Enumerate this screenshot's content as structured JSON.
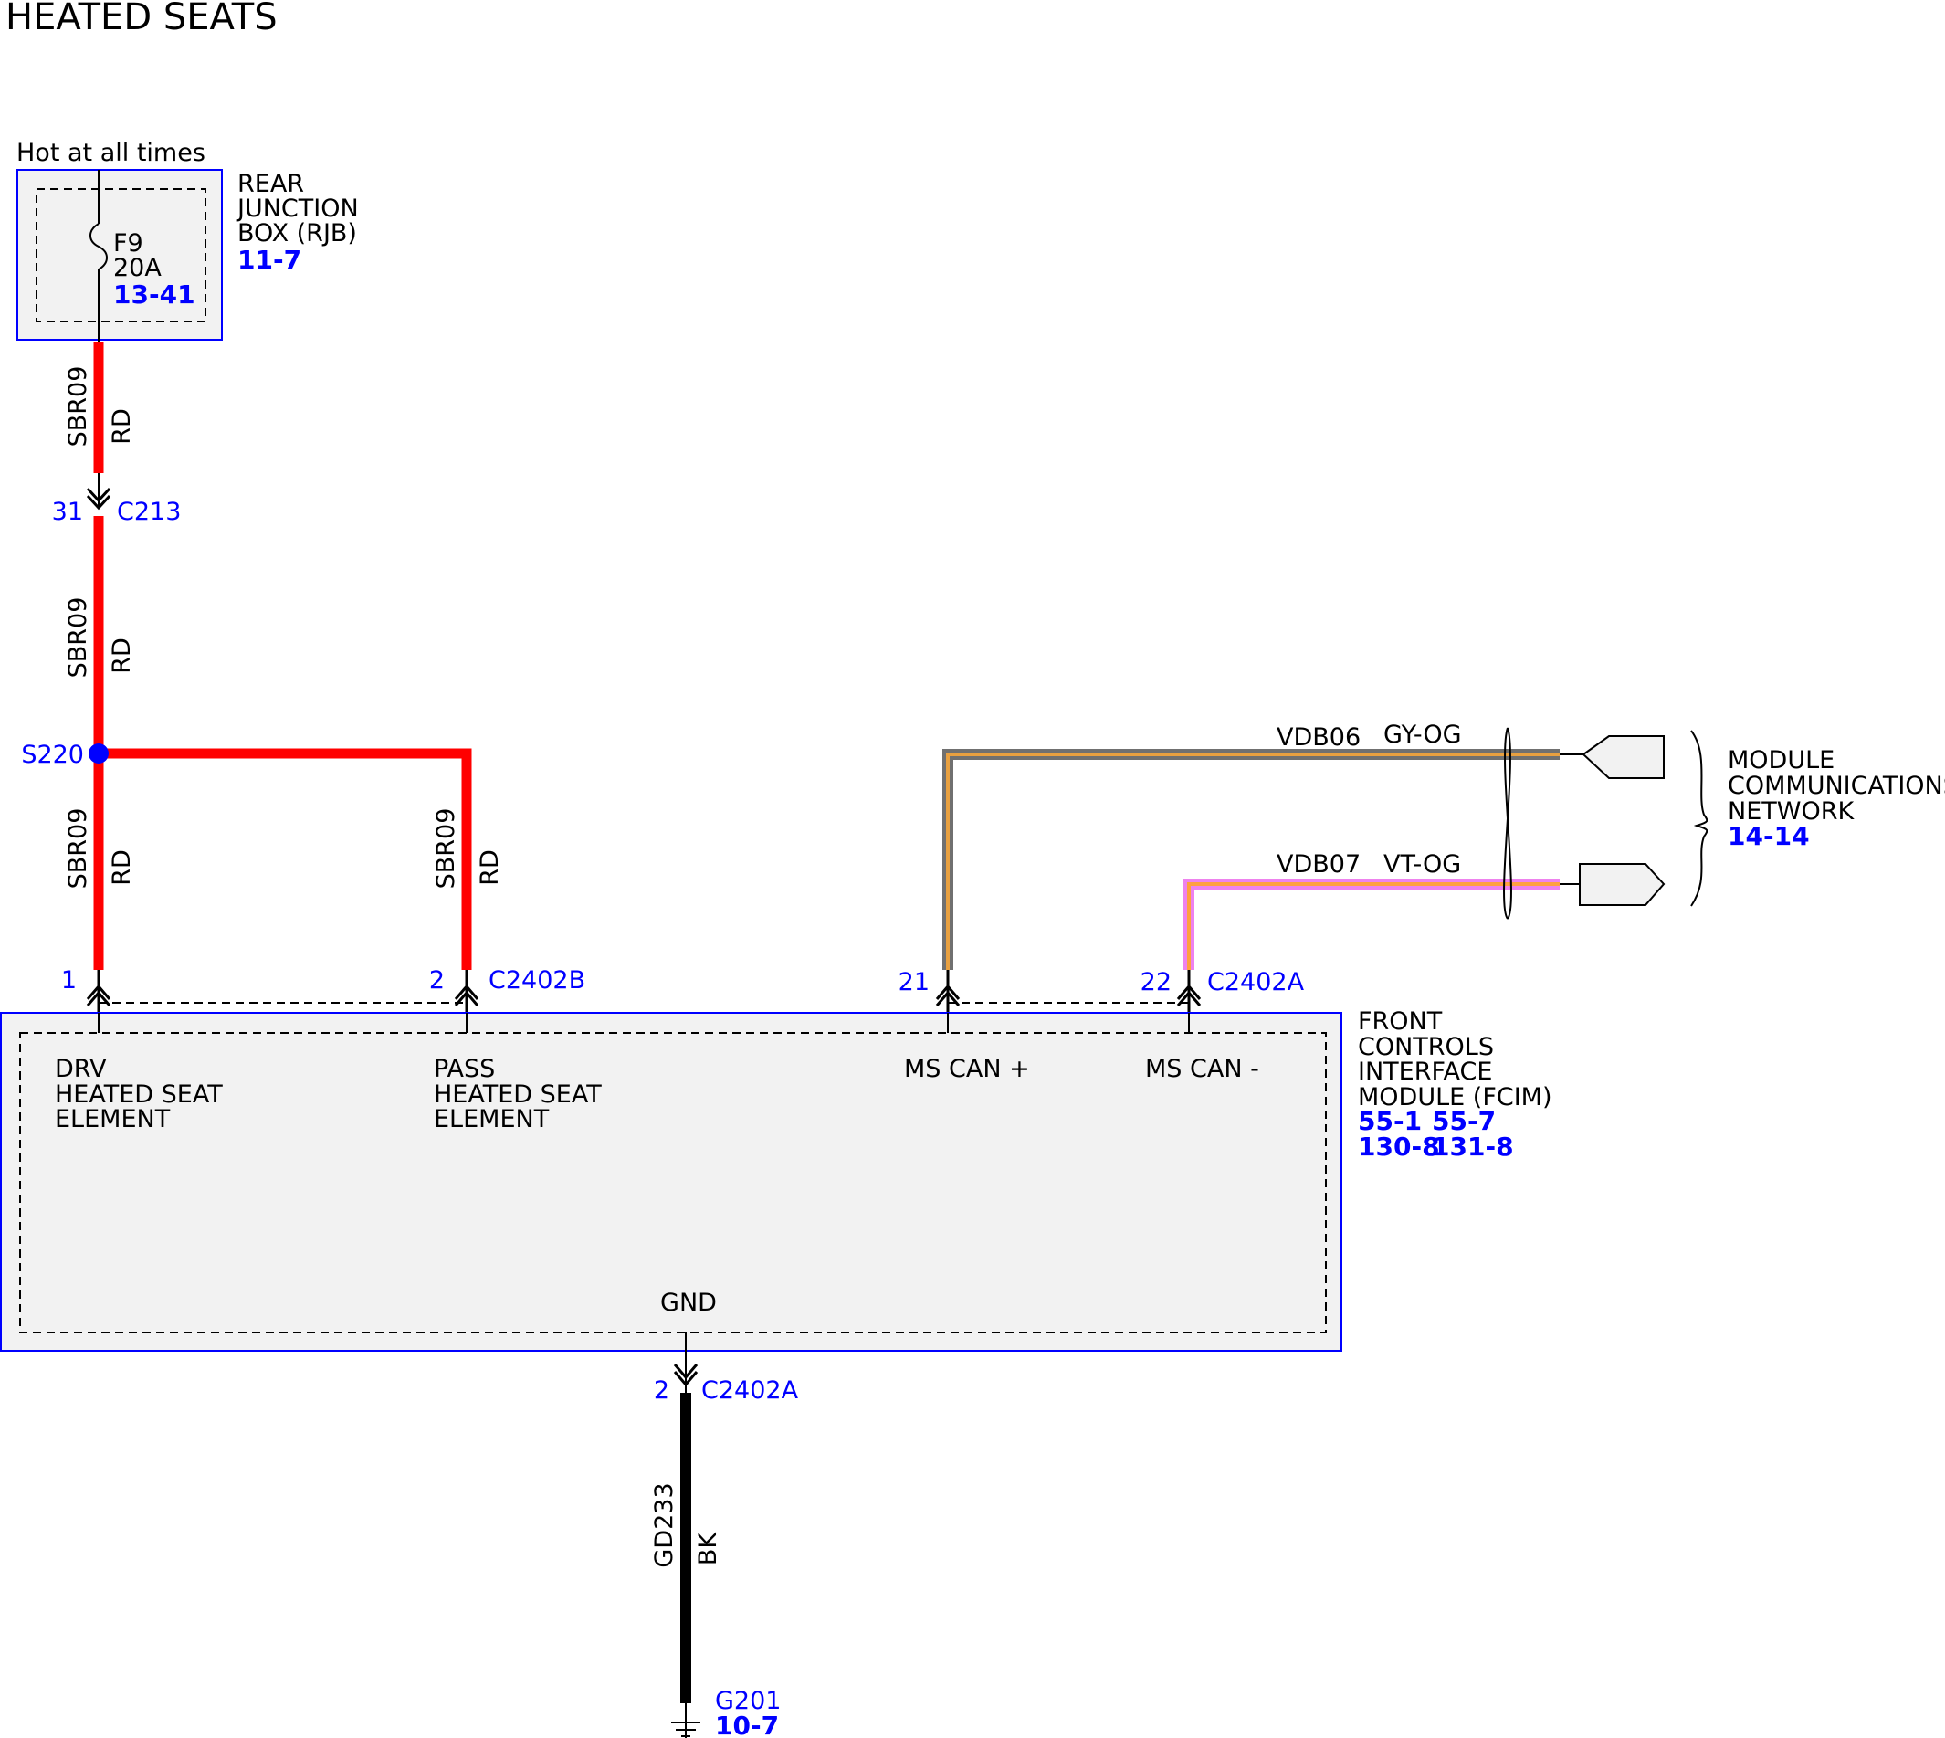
{
  "title": "HEATED SEATS",
  "colors": {
    "wire_red": "#ff0000",
    "wire_black": "#000000",
    "component_border": "#0000ff",
    "component_fill": "#f2f2f2",
    "label_blue": "#0000ff",
    "splice_blue": "#0000ff",
    "gy_og_gray": "#808080",
    "gy_og_orange": "#e8a040",
    "vt_og_violet": "#ee82ee",
    "vt_og_orange": "#ffa040"
  },
  "rjb": {
    "hot_label": "Hot at all times",
    "name_lines": [
      "REAR",
      "JUNCTION",
      "BOX (RJB)"
    ],
    "ref": "11-7",
    "fuse_name": "F9",
    "fuse_rating": "20A",
    "fuse_ref": "13-41"
  },
  "wires": {
    "sbr09_top": {
      "circuit": "SBR09",
      "color": "RD"
    },
    "sbr09_mid": {
      "circuit": "SBR09",
      "color": "RD"
    },
    "sbr09_drv": {
      "circuit": "SBR09",
      "color": "RD"
    },
    "sbr09_pass": {
      "circuit": "SBR09",
      "color": "RD"
    },
    "vdb06": {
      "circuit": "VDB06",
      "color": "GY-OG"
    },
    "vdb07": {
      "circuit": "VDB07",
      "color": "VT-OG"
    },
    "gd233": {
      "circuit": "GD233",
      "color": "BK"
    }
  },
  "c213": {
    "pin": "31",
    "name": "C213"
  },
  "splice": {
    "name": "S220"
  },
  "fcim_pins": {
    "drv_pin": "1",
    "pass_pin": "2",
    "c2402b": "C2402B",
    "mscan_plus_pin": "21",
    "mscan_minus_pin": "22",
    "c2402a": "C2402A",
    "gnd_pin": "2",
    "gnd_connector": "C2402A"
  },
  "fcim": {
    "name_lines": [
      "FRONT",
      "CONTROLS",
      "INTERFACE",
      "MODULE (FCIM)"
    ],
    "refs": [
      "55-1",
      "55-7",
      "130-8",
      "131-8"
    ],
    "drv_label": [
      "DRV",
      "HEATED SEAT",
      "ELEMENT"
    ],
    "pass_label": [
      "PASS",
      "HEATED SEAT",
      "ELEMENT"
    ],
    "mscan_plus": "MS CAN +",
    "mscan_minus": "MS CAN -",
    "gnd": "GND"
  },
  "network": {
    "name_lines": [
      "MODULE",
      "COMMUNICATIONS",
      "NETWORK"
    ],
    "ref": "14-14"
  },
  "ground": {
    "name": "G201",
    "ref": "10-7"
  }
}
